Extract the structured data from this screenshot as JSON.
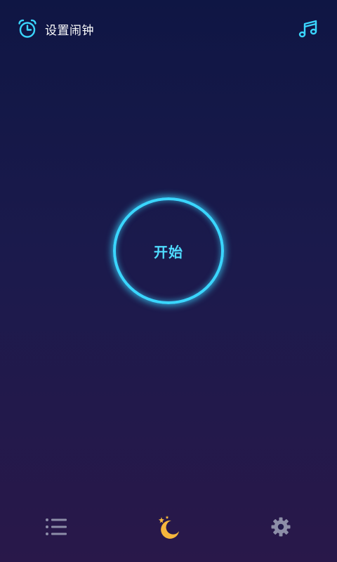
{
  "header": {
    "alarm_label": "设置闹钟",
    "alarm_icon": "alarm-clock-icon",
    "music_icon": "music-note-icon"
  },
  "main": {
    "start_label": "开始"
  },
  "bottom_nav": {
    "items": [
      {
        "icon": "list-icon",
        "active": false
      },
      {
        "icon": "moon-stars-icon",
        "active": true
      },
      {
        "icon": "gear-icon",
        "active": false
      }
    ]
  },
  "colors": {
    "accent": "#3ad6ff",
    "moon": "#f6b63c",
    "inactive_icon": "#8d8ea8",
    "background_top": "#0f1644",
    "background_bottom": "#29184a"
  }
}
